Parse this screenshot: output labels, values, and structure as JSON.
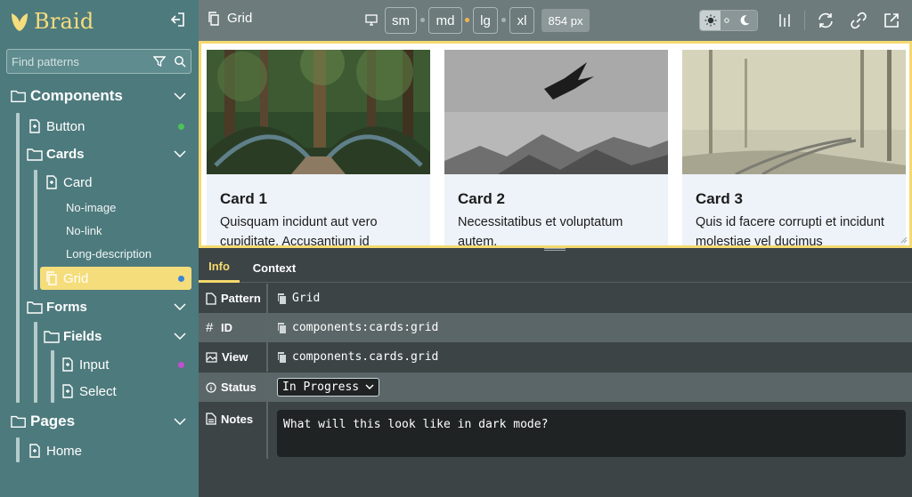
{
  "app": {
    "name": "Braid"
  },
  "sidebar": {
    "search_placeholder": "Find patterns",
    "tree": {
      "components": "Components",
      "button": "Button",
      "cards": "Cards",
      "card": "Card",
      "no_image": "No-image",
      "no_link": "No-link",
      "long_description": "Long-description",
      "grid": "Grid",
      "forms": "Forms",
      "fields": "Fields",
      "input": "Input",
      "select": "Select",
      "pages": "Pages",
      "home": "Home"
    },
    "status_colors": {
      "button": "#4cc25a",
      "grid": "#3b84d9",
      "input": "#c24fd0"
    }
  },
  "toolbar": {
    "title": "Grid",
    "breakpoints": [
      "sm",
      "md",
      "lg",
      "xl"
    ],
    "active_breakpoint_dot_color": "#f0b54a",
    "width_label": "854 px"
  },
  "preview": {
    "cards": [
      {
        "title": "Card 1",
        "description": "Quisquam incidunt aut vero cupiditate. Accusantium id"
      },
      {
        "title": "Card 2",
        "description": "Necessitatibus et voluptatum autem."
      },
      {
        "title": "Card 3",
        "description": "Quis id facere corrupti et incidunt molestiae vel ducimus"
      }
    ]
  },
  "panel": {
    "tabs": [
      "Info",
      "Context"
    ],
    "rows": {
      "pattern": {
        "key": "Pattern",
        "value": "Grid"
      },
      "id": {
        "key": "ID",
        "value": "components:cards:grid"
      },
      "view": {
        "key": "View",
        "value": "components.cards.grid"
      },
      "status": {
        "key": "Status",
        "value": "In Progress"
      },
      "notes": {
        "key": "Notes",
        "value": "What will this look like in dark mode?"
      }
    }
  },
  "colors": {
    "sidebar_bg": "#4d7a7d",
    "accent": "#f5d96e",
    "toolbar_bg": "#6d7b7d",
    "panel_bg": "#3c4446"
  }
}
